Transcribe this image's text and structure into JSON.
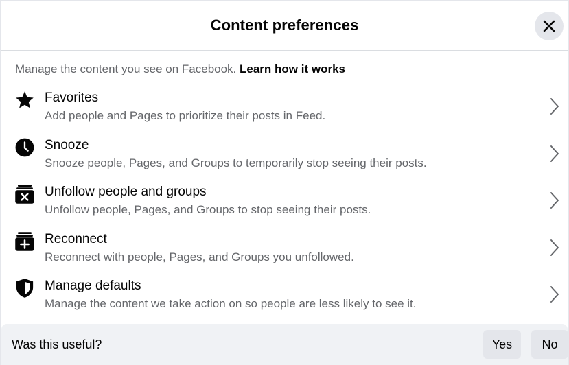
{
  "dialog": {
    "title": "Content preferences",
    "close_icon": "close-icon"
  },
  "intro": {
    "text": "Manage the content you see on Facebook.",
    "link": "Learn how it works"
  },
  "items": [
    {
      "icon": "star-icon",
      "title": "Favorites",
      "desc": "Add people and Pages to prioritize their posts in Feed."
    },
    {
      "icon": "clock-icon",
      "title": "Snooze",
      "desc": "Snooze people, Pages, and Groups to temporarily stop seeing their posts."
    },
    {
      "icon": "unfollow-icon",
      "title": "Unfollow people and groups",
      "desc": "Unfollow people, Pages, and Groups to stop seeing their posts."
    },
    {
      "icon": "reconnect-icon",
      "title": "Reconnect",
      "desc": "Reconnect with people, Pages, and Groups you unfollowed."
    },
    {
      "icon": "shield-icon",
      "title": "Manage defaults",
      "desc": "Manage the content we take action on so people are less likely to see it."
    }
  ],
  "footer": {
    "question": "Was this useful?",
    "yes_label": "Yes",
    "no_label": "No"
  }
}
